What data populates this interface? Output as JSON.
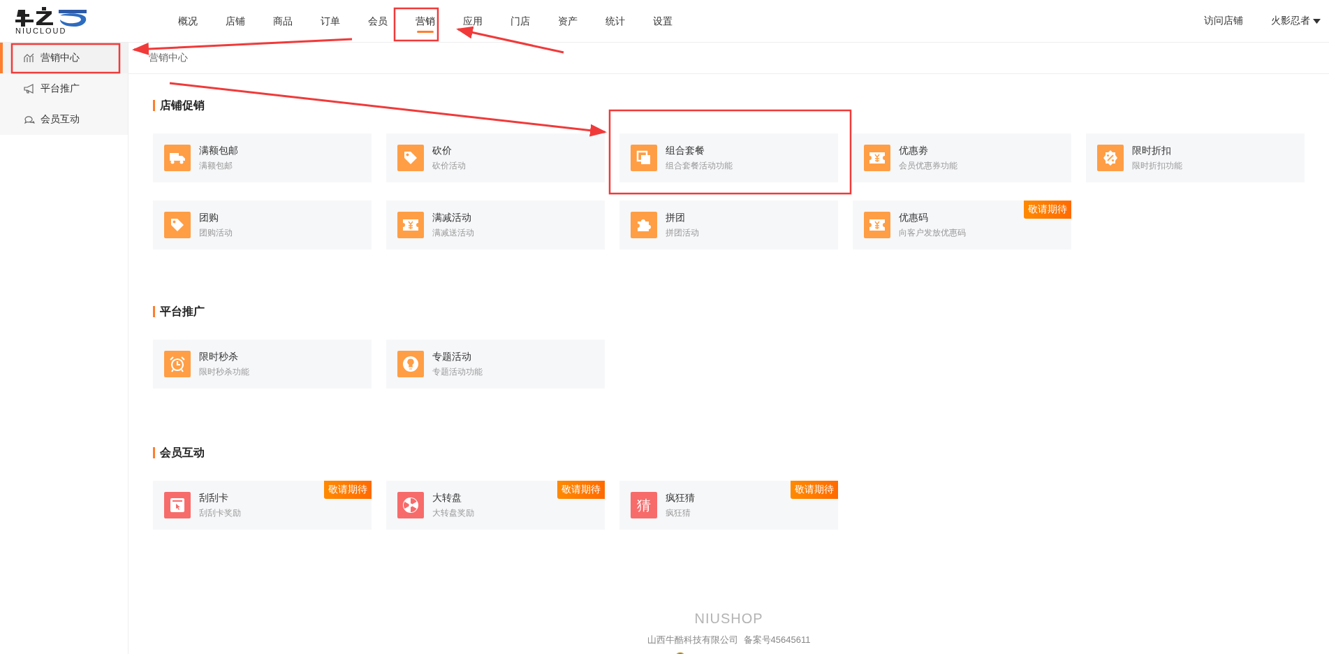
{
  "header": {
    "logo_text": "NIUCLOUD",
    "nav": [
      {
        "label": "概况",
        "selected": false
      },
      {
        "label": "店铺",
        "selected": false
      },
      {
        "label": "商品",
        "selected": false
      },
      {
        "label": "订单",
        "selected": false
      },
      {
        "label": "会员",
        "selected": false
      },
      {
        "label": "营销",
        "selected": true
      },
      {
        "label": "应用",
        "selected": false
      },
      {
        "label": "门店",
        "selected": false
      },
      {
        "label": "资产",
        "selected": false
      },
      {
        "label": "统计",
        "selected": false
      },
      {
        "label": "设置",
        "selected": false
      }
    ],
    "visit_store": "访问店铺",
    "user": "火影忍者"
  },
  "sidebar": {
    "items": [
      {
        "label": "营销中心",
        "selected": true
      },
      {
        "label": "平台推广",
        "selected": false
      },
      {
        "label": "会员互动",
        "selected": false
      }
    ]
  },
  "breadcrumb": "营销中心",
  "sections": [
    {
      "title": "店铺促销",
      "cards": [
        {
          "title": "满额包邮",
          "subtitle": "满额包邮",
          "color": "#ff9e45"
        },
        {
          "title": "砍价",
          "subtitle": "砍价活动",
          "color": "#ff9e45"
        },
        {
          "title": "组合套餐",
          "subtitle": "组合套餐活动功能",
          "color": "#ff9e45"
        },
        {
          "title": "优惠劵",
          "subtitle": "会员优惠券功能",
          "color": "#ff9e45"
        },
        {
          "title": "限时折扣",
          "subtitle": "限时折扣功能",
          "color": "#ff9e45"
        },
        {
          "title": "团购",
          "subtitle": "团购活动",
          "color": "#ff9e45"
        },
        {
          "title": "满减活动",
          "subtitle": "满减送活动",
          "color": "#ff9e45"
        },
        {
          "title": "拼团",
          "subtitle": "拼团活动",
          "color": "#ff9e45"
        },
        {
          "title": "优惠码",
          "subtitle": "向客户发放优惠码",
          "color": "#ff9e45",
          "badge": "敬请期待"
        }
      ]
    },
    {
      "title": "平台推广",
      "cards": [
        {
          "title": "限时秒杀",
          "subtitle": "限时秒杀功能",
          "color": "#ff9e45"
        },
        {
          "title": "专题活动",
          "subtitle": "专题活动功能",
          "color": "#ff9e45"
        }
      ]
    },
    {
      "title": "会员互动",
      "cards": [
        {
          "title": "刮刮卡",
          "subtitle": "刮刮卡奖励",
          "color": "#f76b6b",
          "badge": "敬请期待"
        },
        {
          "title": "大转盘",
          "subtitle": "大转盘奖励",
          "color": "#f76b6b",
          "badge": "敬请期待"
        },
        {
          "title": "疯狂猜",
          "subtitle": "疯狂猜",
          "color": "#f76b6b",
          "badge": "敬请期待",
          "icon_text": "猜"
        }
      ]
    }
  ],
  "footer": {
    "brand": "NIUSHOP",
    "company": "山西牛酷科技有限公司",
    "record": "备案号45645611"
  }
}
